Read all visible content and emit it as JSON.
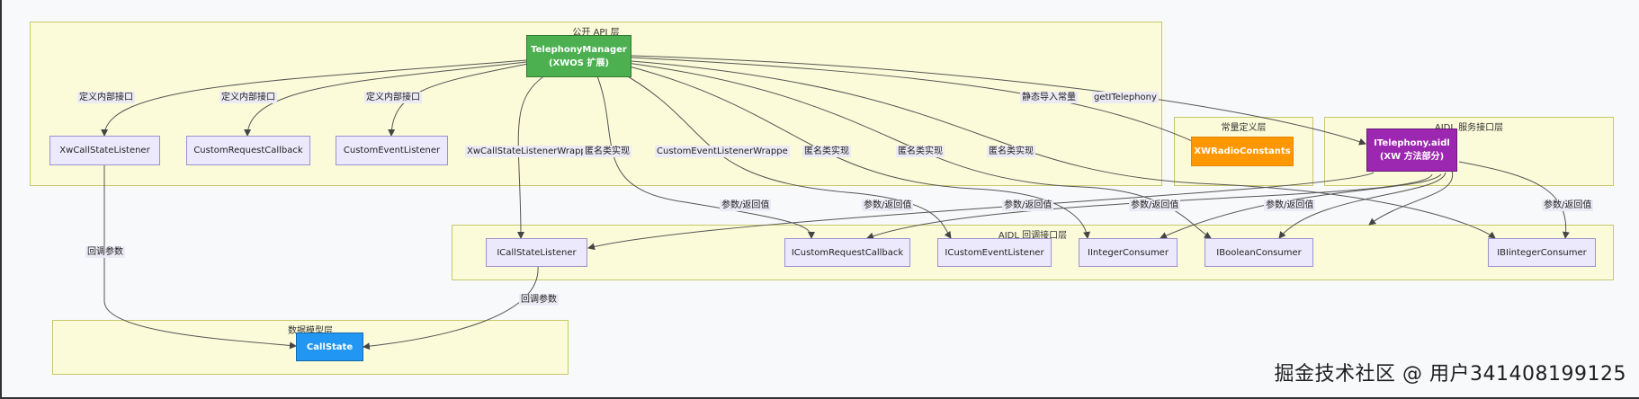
{
  "groups": {
    "public_api": "公开 API 层",
    "constants": "常量定义层",
    "aidl_service": "AIDL 服务接口层",
    "aidl_callback": "AIDL 回调接口层",
    "data_model": "数据模型层"
  },
  "nodes": {
    "telephony_manager": {
      "line1": "TelephonyManager",
      "line2": "(XWOS 扩展)"
    },
    "xw_call_state_listener": "XwCallStateListener",
    "custom_request_callback": "CustomRequestCallback",
    "custom_event_listener": "CustomEventListener",
    "xw_radio_constants": "XWRadioConstants",
    "itelephony_aidl": {
      "line1": "ITelephony.aidl",
      "line2": "(XW 方法部分)"
    },
    "icall_state_listener": "ICallStateListener",
    "icustom_request_callback": "ICustomRequestCallback",
    "icustom_event_listener": "ICustomEventListener",
    "iinteger_consumer": "IIntegerConsumer",
    "iboolean_consumer": "IBooleanConsumer",
    "ibinteger_consumer": "IBIintegerConsumer",
    "call_state": "CallState"
  },
  "edge_labels": {
    "define_internal_1": "定义内部接口",
    "define_internal_2": "定义内部接口",
    "define_internal_3": "定义内部接口",
    "wrapper_1": "XwCallStateListenerWrapper",
    "anon_1": "匿名类实现",
    "wrapper_2": "CustomEventListenerWrappe",
    "anon_2": "匿名类实现",
    "anon_3": "匿名类实现",
    "anon_4": "匿名类实现",
    "static_import": "静态导入常量",
    "get_itelephony": "getITelephony",
    "param_1": "参数/返回值",
    "param_2": "参数/返回值",
    "param_3": "参数/返回值",
    "param_4": "参数/返回值",
    "param_5": "参数/返回值",
    "param_6": "参数/返回值",
    "callback_param_1": "回调参数",
    "callback_param_2": "回调参数"
  },
  "watermark": "掘金技术社区 @ 用户341408199125",
  "colors": {
    "group_bg": "#fbfbd9",
    "node_bg": "#ece9fc",
    "green": "#4caf50",
    "orange": "#ff9800",
    "purple": "#9c27b0",
    "blue": "#2196f3",
    "edge": "#444444"
  }
}
